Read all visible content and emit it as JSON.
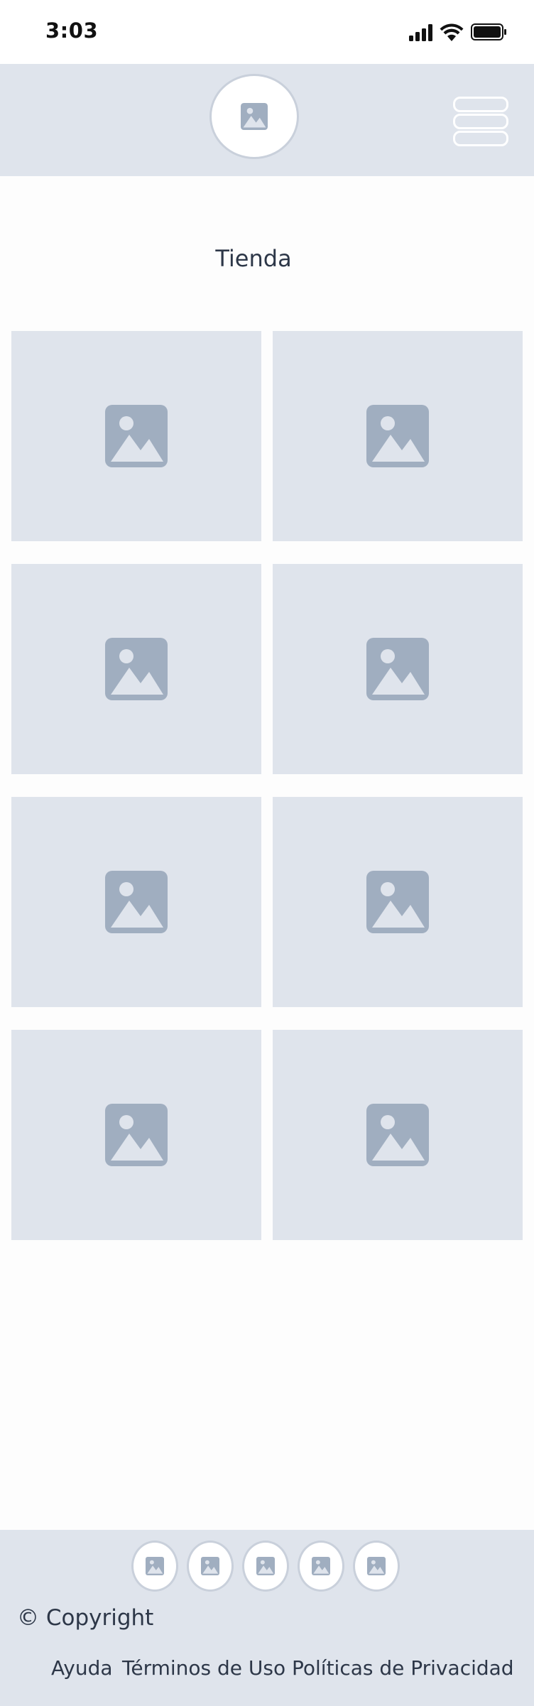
{
  "status_bar": {
    "time": "3:03",
    "icons": [
      "signal-icon",
      "wifi-icon",
      "battery-icon"
    ]
  },
  "header": {
    "logo": "image-placeholder-icon",
    "menu": "hamburger-menu-icon"
  },
  "main": {
    "title": "Tienda",
    "products": [
      {
        "image": "image-placeholder-icon"
      },
      {
        "image": "image-placeholder-icon"
      },
      {
        "image": "image-placeholder-icon"
      },
      {
        "image": "image-placeholder-icon"
      },
      {
        "image": "image-placeholder-icon"
      },
      {
        "image": "image-placeholder-icon"
      },
      {
        "image": "image-placeholder-icon"
      },
      {
        "image": "image-placeholder-icon"
      }
    ]
  },
  "footer": {
    "social_icons": [
      "image-placeholder-icon",
      "image-placeholder-icon",
      "image-placeholder-icon",
      "image-placeholder-icon",
      "image-placeholder-icon"
    ],
    "copyright": "© Copyright",
    "links": [
      "Ayuda",
      "Términos de Uso",
      "Políticas de Privacidad"
    ]
  },
  "colors": {
    "header_bg": "#dfe4ec",
    "placeholder_bg": "#dfe4ec",
    "placeholder_icon": "#a0aec0",
    "text": "#2d3748"
  }
}
